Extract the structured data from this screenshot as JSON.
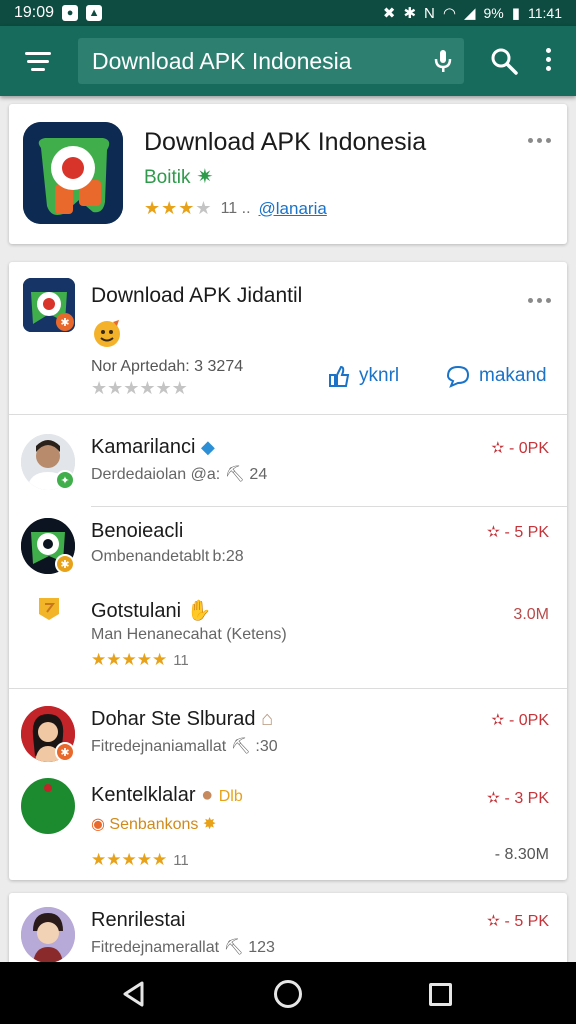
{
  "status_bar": {
    "time": "19:09",
    "battery": "9%",
    "clock": "11:41"
  },
  "app_bar": {
    "search_value": "Download APK Indonesia"
  },
  "hero": {
    "title": "Download APK Indonesia",
    "developer": "Boitik",
    "rating_stars": 3,
    "rating_count": "11 ..",
    "link": "@lanaria"
  },
  "featured": {
    "title": "Download APK Jidantil",
    "subtitle": "Nor Aprtedah: 3 3274",
    "rating_stars": 0,
    "action1_label": "yknrl",
    "action2_label": "makand"
  },
  "list": [
    {
      "title": "Kamarilanci",
      "subtitle": "Derdedaiolan @a: ⛏ 24",
      "size": "✫ - 0PK"
    },
    {
      "title": "Benoieacli",
      "subtitle": "Ombenandetablt b:28",
      "size": "✫ - 5 PK"
    },
    {
      "title": "Gotstulani",
      "subtitle": "Man Henanecahat (Ketens)",
      "size": "3.0M",
      "rating_count": "11"
    },
    {
      "title": "Dohar Ste Slburad",
      "subtitle": "Fitredejnaniamallat ⛏ :30",
      "size": "✫ - 0PK"
    },
    {
      "title": "Kentelklalar",
      "extra": "Dlb",
      "subtitle": "Senbankons",
      "size": "✫ - 3 PK",
      "size2": "- 8.30M",
      "rating_count": "11"
    },
    {
      "title": "Renrilestai",
      "subtitle": "Fitredejnamerallat ⛏ 123",
      "size": "✫ - 5 PK"
    }
  ],
  "colors": {
    "status_bar": "#0e4b40",
    "app_bar": "#176b5c",
    "accent_green": "#2e9a4a",
    "link_blue": "#1a73c8",
    "size_red": "#c6343a",
    "star": "#e8a21a"
  },
  "icons": [
    "menu-icon",
    "mic-icon",
    "search-icon",
    "overflow-icon",
    "share-icon",
    "chat-icon",
    "back-icon",
    "home-icon",
    "recents-icon"
  ]
}
